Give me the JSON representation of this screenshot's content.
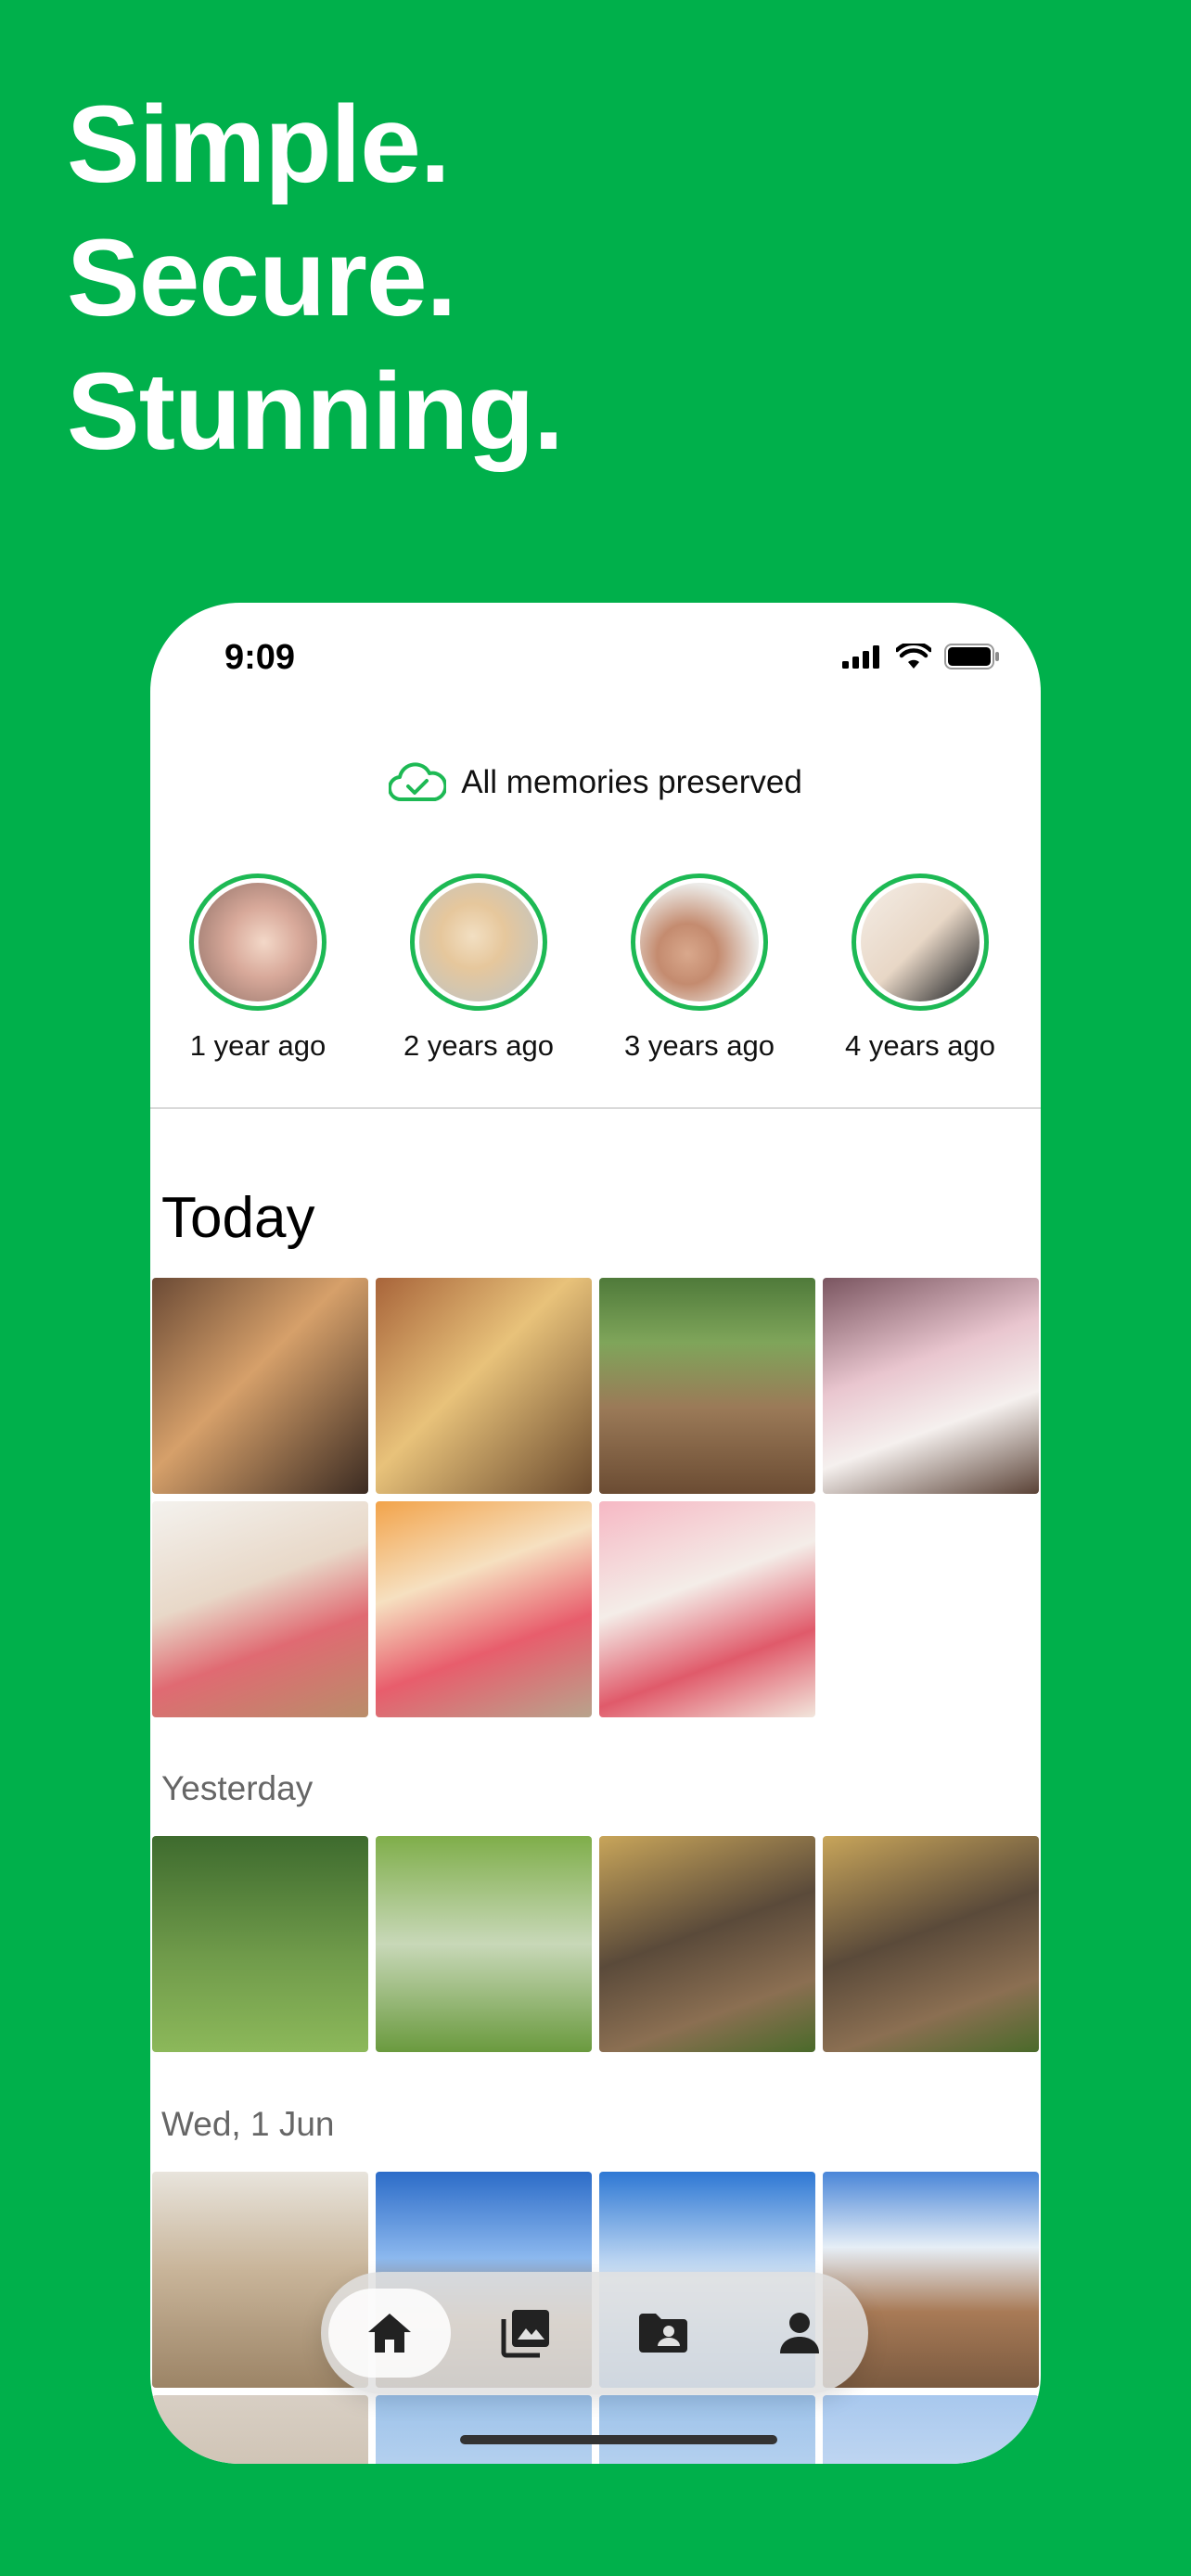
{
  "hero": {
    "lines": [
      "Simple.",
      "Secure.",
      "Stunning."
    ]
  },
  "status": {
    "time": "9:09"
  },
  "backup": {
    "label": "All memories preserved",
    "icon": "cloud-check-icon"
  },
  "memories": [
    {
      "label": "1 year ago"
    },
    {
      "label": "2 years ago"
    },
    {
      "label": "3 years ago"
    },
    {
      "label": "4 years ago"
    }
  ],
  "sections": {
    "today": "Today",
    "yesterday": "Yesterday",
    "wed": "Wed, 1 Jun"
  },
  "tabs": [
    {
      "name": "home",
      "icon": "home-icon",
      "active": true
    },
    {
      "name": "gallery",
      "icon": "photo-library-icon",
      "active": false
    },
    {
      "name": "albums",
      "icon": "shared-folder-icon",
      "active": false
    },
    {
      "name": "account",
      "icon": "person-icon",
      "active": false
    }
  ],
  "colors": {
    "brand": "#00B04B",
    "ring": "#1DB954"
  }
}
